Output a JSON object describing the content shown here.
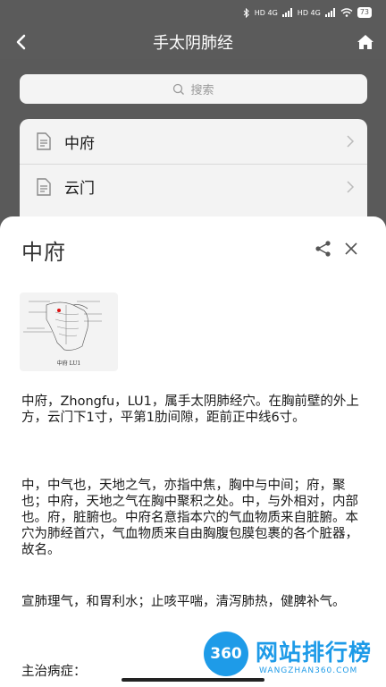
{
  "status_bar": {
    "signal_1": "HD 4G",
    "signal_2": "HD 4G",
    "battery": "73"
  },
  "nav": {
    "title": "手太阴肺经",
    "back_icon": "back-arrow-icon",
    "home_icon": "home-icon"
  },
  "search": {
    "placeholder": "搜索",
    "icon": "search-icon"
  },
  "list": {
    "items": [
      {
        "label": "中府"
      },
      {
        "label": "云门"
      }
    ]
  },
  "sheet": {
    "title": "中府",
    "figure_caption": "中府    LU1",
    "paragraphs": [
      "中府，Zhongfu，LU1，属手太阴肺经穴。在胸前壁的外上方，云门下1寸，平第1肋间隙，距前正中线6寸。",
      "中，中气也，天地之气，亦指中焦，胸中与中间；府，聚也；中府，天地之气在胸中聚积之处。中，与外相对，内部也。府，脏腑也。中府名意指本穴的气血物质来自脏腑。本穴为肺经首穴，气血物质来自由胸腹包膜包裹的各个脏器，故名。",
      "宣肺理气，和胃利水；止咳平喘，清泻肺热，健脾补气。",
      "主治病症："
    ]
  },
  "watermark": {
    "logo_text": "360",
    "name": "网站排行榜",
    "url": "WANGZHAN360.COM"
  },
  "colors": {
    "header_bg": "#5b5b5b",
    "sheet_bg": "#ffffff",
    "watermark_blue": "#1e9be8"
  }
}
